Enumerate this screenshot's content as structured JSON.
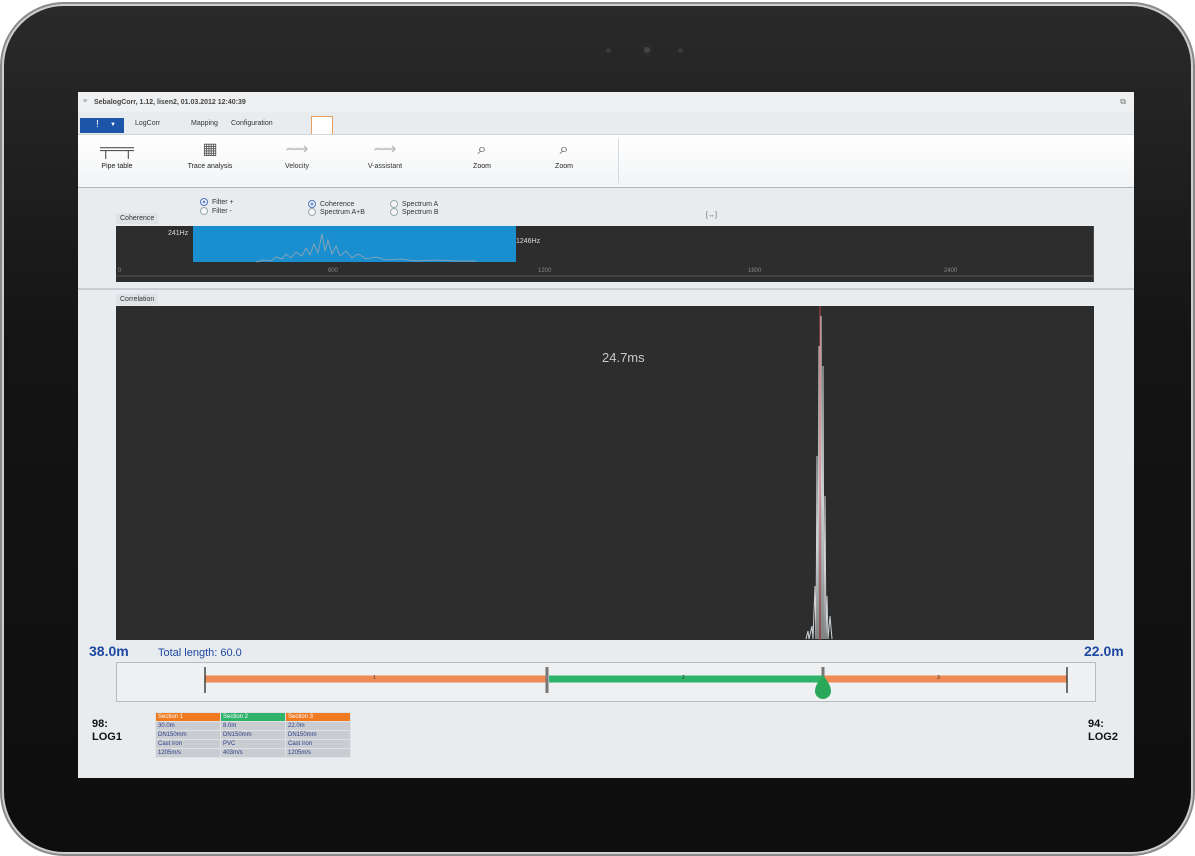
{
  "window": {
    "title": "SebalogCorr, 1.12, lisen2, 01.03.2012 12:40:39"
  },
  "tabs": [
    {
      "label": "LogCorr"
    },
    {
      "label": "Mapping"
    },
    {
      "label": "Configuration"
    }
  ],
  "ribbon": [
    {
      "label": "Pipe table",
      "icon": "pipe-icon",
      "enabled": true
    },
    {
      "label": "Trace analysis",
      "icon": "grid-icon",
      "enabled": true
    },
    {
      "label": "Velocity",
      "icon": "velocity-icon",
      "enabled": false
    },
    {
      "label": "V-assistant",
      "icon": "v-assistant-icon",
      "enabled": false
    },
    {
      "label": "Zoom",
      "icon": "zoom-in-icon",
      "enabled": true
    },
    {
      "label": "Zoom",
      "icon": "zoom-out-icon",
      "enabled": true
    }
  ],
  "coherence": {
    "label": "Coherence",
    "filter_options": [
      {
        "label": "Filter +",
        "selected": true
      },
      {
        "label": "Filter -",
        "selected": false
      }
    ],
    "view_options": [
      {
        "label": "Coherence",
        "selected": true
      },
      {
        "label": "Spectrum A+B",
        "selected": false
      },
      {
        "label": "Spectrum A",
        "selected": false
      },
      {
        "label": "Spectrum B",
        "selected": false
      }
    ],
    "expand_label": "[↔]",
    "band_low_label": "241Hz",
    "band_high_label": "1246Hz",
    "band_low_hz": 241,
    "band_high_hz": 1246,
    "axis_ticks": [
      "0",
      "600",
      "1200",
      "1800",
      "2400"
    ],
    "band_color": "#1a8fd0"
  },
  "correlation": {
    "label": "Correlation",
    "peak_label": "24.7ms",
    "peak_color": "#e05050"
  },
  "pipe": {
    "left_distance": "38.0m",
    "total_length": "Total length: 60.0",
    "right_distance": "22.0m",
    "segments": [
      {
        "label": "1",
        "color": "#f08a55"
      },
      {
        "label": "2",
        "color": "#2fb36a"
      },
      {
        "label": "3",
        "color": "#f08a55"
      }
    ],
    "leak_marker_color": "#2aa85a"
  },
  "loggers": {
    "left": {
      "line1": "98:",
      "line2": "LOG1"
    },
    "right": {
      "line1": "94:",
      "line2": "LOG2"
    }
  },
  "sections": {
    "headers": [
      "Section 1",
      "Section 2",
      "Section 3"
    ],
    "header_colors": [
      "#f07a20",
      "#2fb36a",
      "#f07a20"
    ],
    "rows": [
      [
        "30.0m",
        "8.0m",
        "22.0m"
      ],
      [
        "DN150mm",
        "DN150mm",
        "DN150mm"
      ],
      [
        "Cast iron",
        "PVC",
        "Cast iron"
      ],
      [
        "1205m/s",
        "403m/s",
        "1205m/s"
      ]
    ]
  }
}
